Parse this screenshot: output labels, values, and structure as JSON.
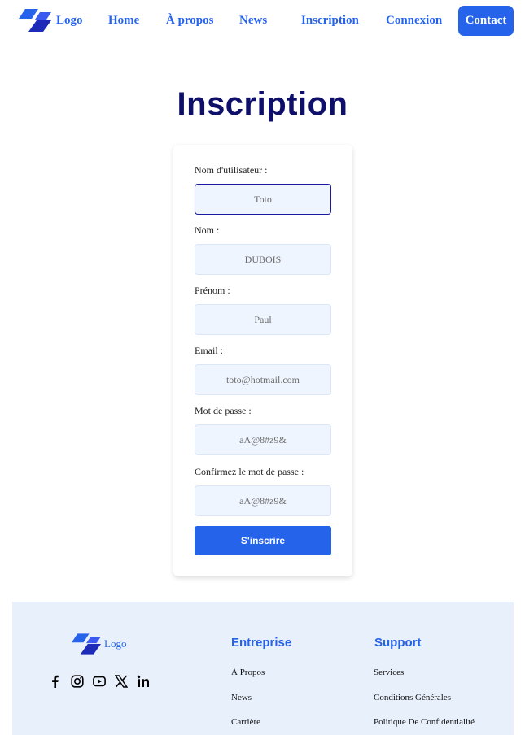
{
  "header": {
    "logo_text": "Logo",
    "nav": {
      "home": "Home",
      "about": "À propos",
      "news": "News",
      "signup": "Inscription",
      "login": "Connexion"
    },
    "contact_label": "Contact"
  },
  "page": {
    "title": "Inscription"
  },
  "form": {
    "fields": [
      {
        "label": "Nom d'utilisateur :",
        "placeholder": "Toto"
      },
      {
        "label": "Nom :",
        "placeholder": "DUBOIS"
      },
      {
        "label": "Prénom :",
        "placeholder": "Paul"
      },
      {
        "label": "Email :",
        "placeholder": "toto@hotmail.com"
      },
      {
        "label": "Mot de passe :",
        "placeholder": "aA@8#z9&"
      },
      {
        "label": "Confirmez le mot de passe :",
        "placeholder": "aA@8#z9&"
      }
    ],
    "submit_label": "S'inscrire"
  },
  "footer": {
    "logo_text": "Logo",
    "socials": [
      "facebook-icon",
      "instagram-icon",
      "youtube-icon",
      "x-icon",
      "linkedin-icon"
    ],
    "company": {
      "title": "Entreprise",
      "links": [
        "À Propos",
        "News",
        "Carrière"
      ]
    },
    "support": {
      "title": "Support",
      "links": [
        "Services",
        "Conditions Générales",
        "Politique De Confidentialité"
      ]
    }
  },
  "colors": {
    "primary": "#2563eb",
    "title": "#0d0f6b",
    "input_bg": "#eff5ff",
    "footer_bg": "#e8f0fc"
  }
}
